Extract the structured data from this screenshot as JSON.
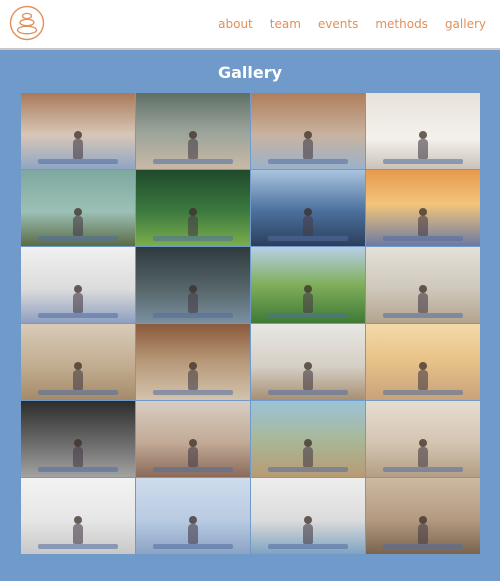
{
  "nav": {
    "items": [
      {
        "name": "nav-about",
        "label": "about"
      },
      {
        "name": "nav-team",
        "label": "team"
      },
      {
        "name": "nav-events",
        "label": "events"
      },
      {
        "name": "nav-methods",
        "label": "methods"
      },
      {
        "name": "nav-gallery",
        "label": "gallery"
      }
    ],
    "accent": "#e0905a"
  },
  "logo": {
    "icon": "stacked-stones-logo",
    "color": "#e0905a"
  },
  "main": {
    "title": "Gallery",
    "background": "#6f9ac9"
  },
  "gallery": {
    "images": [
      {
        "name": "gallery-image-group-class-brick-studio",
        "background": "linear-gradient(180deg,#a97a5a 0%,#d8c7b8 55%,#8fa6c4 100%)"
      },
      {
        "name": "gallery-image-tree-pose-window-studio",
        "background": "linear-gradient(180deg,#5f6f66 0%,#9aa39a 50%,#c9b9a6 100%)"
      },
      {
        "name": "gallery-image-seated-group-brick-wall",
        "background": "linear-gradient(180deg,#b07d5c 0%,#c9b3a0 55%,#9bb2c9 100%)"
      },
      {
        "name": "gallery-image-woman-meditating-white-room",
        "background": "linear-gradient(180deg,#e8e2da 0%,#f4f1ec 60%,#c9c2b8 100%)"
      },
      {
        "name": "gallery-image-tree-pose-lake-rock",
        "background": "linear-gradient(180deg,#7ea8a0 0%,#9cc0b6 55%,#5a6b44 100%)"
      },
      {
        "name": "gallery-image-meditation-forest",
        "background": "linear-gradient(180deg,#1f4a2c 0%,#3d7a3f 55%,#7bae4c 100%)"
      },
      {
        "name": "gallery-image-meditation-lake-mountains",
        "background": "linear-gradient(180deg,#a9c4de 0%,#4a6f9c 55%,#2c3f5c 100%)"
      },
      {
        "name": "gallery-image-sunset-silhouette-water",
        "background": "linear-gradient(180deg,#e79a4e 0%,#f2c47a 45%,#6c7aa3 100%)"
      },
      {
        "name": "gallery-image-side-stretch-white-studio",
        "background": "linear-gradient(180deg,#f1f1f1 0%,#dcdcdc 55%,#8f9fc0 100%)"
      },
      {
        "name": "gallery-image-class-stretch-dark-studio",
        "background": "linear-gradient(180deg,#2f3a3e 0%,#56666a 55%,#7a8fa0 100%)"
      },
      {
        "name": "gallery-image-prayer-pose-meadow",
        "background": "linear-gradient(180deg,#b8cfe6 0%,#7fae5a 50%,#3f7a36 100%)"
      },
      {
        "name": "gallery-image-group-warrior-bright-hall",
        "background": "linear-gradient(180deg,#e4e1da 0%,#cfc8bb 55%,#b3a48e 100%)"
      },
      {
        "name": "gallery-image-reclined-twist-mats",
        "background": "linear-gradient(180deg,#d8cbb8 0%,#c2ad90 55%,#a58a6a 100%)"
      },
      {
        "name": "gallery-image-group-seated-plants",
        "background": "linear-gradient(180deg,#8a5a3c 0%,#b89a7a 50%,#d3c2ac 100%)"
      },
      {
        "name": "gallery-image-seated-row-windows",
        "background": "linear-gradient(180deg,#e7e7e3 0%,#d6d0c6 55%,#a78f74 100%)"
      },
      {
        "name": "gallery-image-childs-pose-sunlight",
        "background": "linear-gradient(180deg,#f4d9a8 0%,#e9c48a 45%,#c8a27a 100%)"
      },
      {
        "name": "gallery-image-forward-bend-monochrome",
        "background": "linear-gradient(180deg,#2c2c2c 0%,#6b6b6b 55%,#a2a2a2 100%)"
      },
      {
        "name": "gallery-image-woman-smiling-studio",
        "background": "linear-gradient(180deg,#d8cdc3 0%,#c2aa96 55%,#8a6a58 100%)"
      },
      {
        "name": "gallery-image-outdoor-terrace-class",
        "background": "linear-gradient(180deg,#9cc3d8 0%,#a8b89a 50%,#b89b72 100%)"
      },
      {
        "name": "gallery-image-pose-with-strap",
        "background": "linear-gradient(180deg,#e6ddd2 0%,#d4c5b2 55%,#b39e84 100%)"
      },
      {
        "name": "gallery-image-crescent-lunge-white",
        "background": "linear-gradient(180deg,#f3f3f3 0%,#e6e6e6 55%,#c8c8c8 100%)"
      },
      {
        "name": "gallery-image-bridge-pose-blue",
        "background": "linear-gradient(180deg,#cfdced 0%,#b9cbe2 55%,#8ba3c4 100%)"
      },
      {
        "name": "gallery-image-warrior-pose-white-room",
        "background": "linear-gradient(180deg,#eeeeee 0%,#dcdcdc 55%,#7fa3c0 100%)"
      },
      {
        "name": "gallery-image-dancer-pose-living-room",
        "background": "linear-gradient(180deg,#cdb9a2 0%,#b39a80 55%,#7a6450 100%)"
      }
    ]
  }
}
